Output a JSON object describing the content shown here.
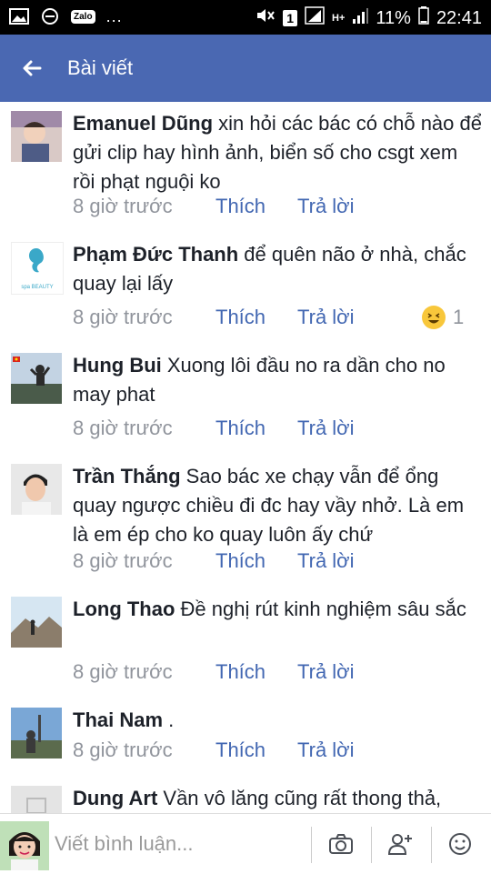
{
  "status_bar": {
    "zalo_label": "Zalo",
    "dots": "...",
    "sim_badge": "1",
    "network": "H+",
    "battery": "11%",
    "time": "22:41"
  },
  "app_bar": {
    "title": "Bài viết"
  },
  "comments": [
    {
      "author": "Emanuel Dũng",
      "text": " xin hỏi các bác có chỗ nào để gửi clip hay hình ảnh, biển số cho csgt xem rồi phạt nguội ko",
      "time": "8 giờ trước",
      "like": "Thích",
      "reply": "Trả lời"
    },
    {
      "author": "Phạm Đức Thanh",
      "text": " để quên não ở nhà, chắc quay lại lấy",
      "time": "8 giờ trước",
      "like": "Thích",
      "reply": "Trả lời",
      "reaction_count": "1",
      "reaction_icon": "laughing-emoji-icon"
    },
    {
      "author": "Hung Bui",
      "text": " Xuong lôi đầu no ra dần cho no may phat",
      "time": "8 giờ trước",
      "like": "Thích",
      "reply": "Trả lời"
    },
    {
      "author": "Trần Thắng",
      "text": " Sao bác xe chạy vẫn để ổng quay ngược chiều đi đc hay vầy nhở. Là em là em ép cho ko quay luôn ấy chứ",
      "time": "8 giờ trước",
      "like": "Thích",
      "reply": "Trả lời"
    },
    {
      "author": "Long Thao",
      "text": " Đề nghị rút kinh nghiệm sâu sắc",
      "time": "8 giờ trước",
      "like": "Thích",
      "reply": "Trả lời"
    },
    {
      "author": "Thai Nam",
      "text": " .",
      "time": "8 giờ trước",
      "like": "Thích",
      "reply": "Trả lời"
    },
    {
      "author": "Dung Art",
      "text": " Vần vô lăng cũng rất thong thả,"
    }
  ],
  "avatar_texts": {
    "spa_label": "spa BEAUTY"
  },
  "composer": {
    "placeholder": "Viết bình luận...",
    "icons": [
      "camera-icon",
      "add-friend-icon",
      "smiley-icon"
    ]
  },
  "colors": {
    "app_bar": "#4a68b2",
    "link": "#4267b2",
    "meta": "#90949c"
  }
}
